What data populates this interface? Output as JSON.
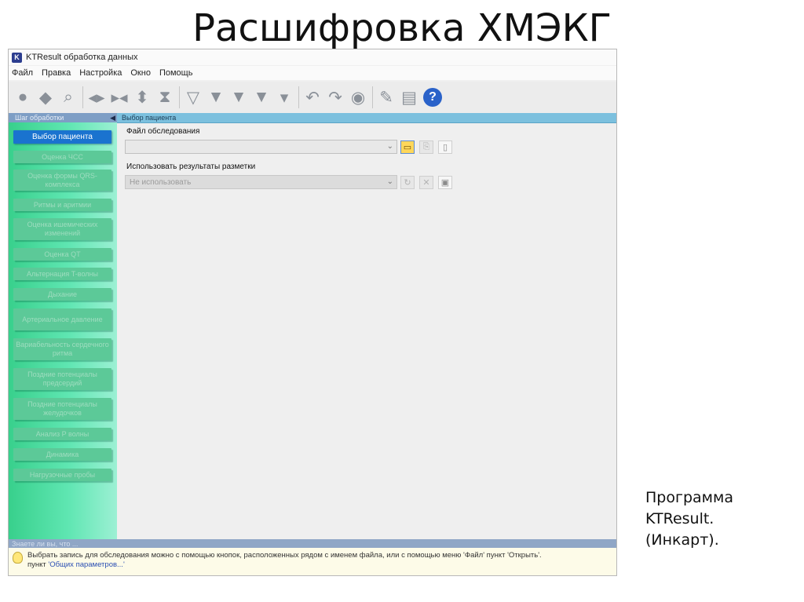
{
  "slide": {
    "title": "Расшифровка ХМЭКГ",
    "caption": [
      "Программа",
      "KTResult.",
      "(Инкарт)."
    ]
  },
  "window": {
    "title": "KTResult обработка данных",
    "app_icon": "kt-logo-icon"
  },
  "menu": [
    "Файл",
    "Правка",
    "Настройка",
    "Окно",
    "Помощь"
  ],
  "toolbar_icons": [
    "play-circle-icon",
    "erase-icon",
    "magnifier-icon",
    "split-horizontal-icon",
    "merge-horizontal-icon",
    "split-vertical-icon",
    "merge-vertical-icon",
    "filter-left-icon",
    "filter-right-icon",
    "filter-35-icon",
    "filter-50-icon",
    "filter-underline-icon",
    "undo-icon",
    "redo-icon",
    "globe-icon",
    "wrench-icon",
    "document-icon",
    "help-icon"
  ],
  "sidebar": {
    "header": "Шаг обработки",
    "steps": [
      {
        "label": "Выбор пациента",
        "active": true
      },
      {
        "label": "Оценка ЧСС"
      },
      {
        "label": "Оценка формы QRS-комплекса"
      },
      {
        "label": "Ритмы и аритмии"
      },
      {
        "label": "Оценка ишемических изменений"
      },
      {
        "label": "Оценка QT"
      },
      {
        "label": "Альтернация T-волны"
      },
      {
        "label": "Дыхание"
      },
      {
        "label": "Артериальное давление"
      },
      {
        "label": "Вариабельность сердечного ритма"
      },
      {
        "label": "Поздние потенциалы предсердий"
      },
      {
        "label": "Поздние потенциалы желудочков"
      },
      {
        "label": "Анализ P волны"
      },
      {
        "label": "Динамика"
      },
      {
        "label": "Нагрузочные пробы"
      }
    ]
  },
  "content": {
    "header": "Выбор пациента",
    "file_label": "Файл обследования",
    "file_value": "",
    "markup_label": "Использовать результаты разметки",
    "markup_value": "Не использовать"
  },
  "status": {
    "label": "Знаете ли вы, что ...",
    "hint": "Выбрать запись для обследования можно с помощью кнопок, расположенных рядом с именем файла, или с помощью меню 'Файл' пункт 'Открыть'.",
    "hint_prefix": "пункт",
    "hint_link": "'Общих параметров...'"
  }
}
